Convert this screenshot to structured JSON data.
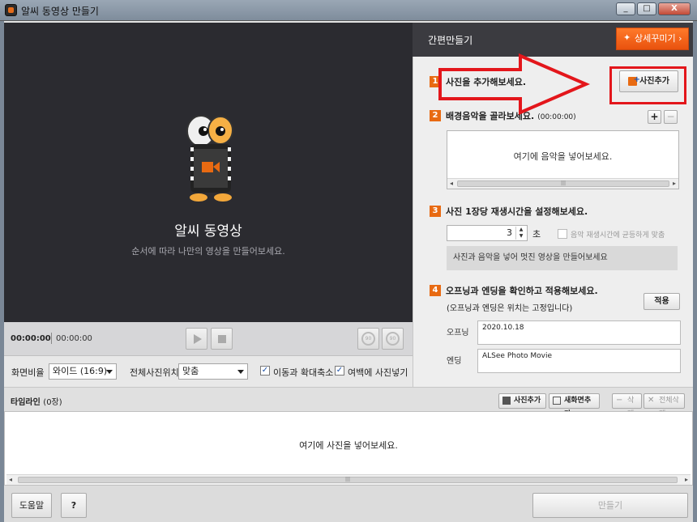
{
  "window": {
    "title": "알씨 동영상 만들기",
    "min": "_",
    "max": "□",
    "close": "X"
  },
  "preview": {
    "title": "알씨 동영상",
    "subtitle": "순서에 따라 나만의 영상을 만들어보세요.",
    "current_time": "00:00:00",
    "total_time": "00:00:00",
    "rotate_left": "90",
    "rotate_right": "90"
  },
  "options": {
    "aspect_label": "화면비율",
    "aspect_value": "와이드 (16:9)",
    "position_label": "전체사진위치",
    "position_value": "맞춤",
    "zoom_label": "이동과 확대축소",
    "zoom_checked": "✓",
    "fill_label": "여백에 사진넣기",
    "fill_checked": "✓"
  },
  "panel": {
    "title": "간편만들기",
    "deco_button": "상세꾸미기",
    "step1": {
      "num": "1",
      "text": "사진을 추가해보세요.",
      "add_button": "사진추가"
    },
    "step2": {
      "num": "2",
      "text": "배경음악을 골라보세요.",
      "duration": "(00:00:00)",
      "plus": "+",
      "minus": "−",
      "placeholder": "여기에 음악을 넣어보세요."
    },
    "step3": {
      "num": "3",
      "text": "사진 1장당 재생시간을 설정해보세요.",
      "seconds": "3",
      "unit": "초",
      "sync_label": "음악 재생시간에 균등하게 맞춤",
      "hint": "사진과 음악을 넣어 멋진 영상을 만들어보세요"
    },
    "step4": {
      "num": "4",
      "text": "오프닝과 엔딩을 확인하고 적용해보세요.",
      "note": "(오프닝과 엔딩은 위치는 고정입니다)",
      "apply_button": "적용",
      "opening_label": "오프닝",
      "opening_value": "2020.10.18",
      "ending_label": "엔딩",
      "ending_value": "ALSee Photo Movie"
    }
  },
  "timeline": {
    "title": "타임라인",
    "count": "(0장)",
    "add_photo": "사진추가",
    "new_screen": "새화면추가",
    "delete": "삭제",
    "delete_all": "전체삭제",
    "placeholder": "여기에 사진을 넣어보세요."
  },
  "footer": {
    "help": "도움말",
    "question": "?",
    "make": "만들기"
  },
  "colors": {
    "accent": "#e86a12",
    "annotation": "#e3161b",
    "dark_panel": "#2b2b30"
  }
}
